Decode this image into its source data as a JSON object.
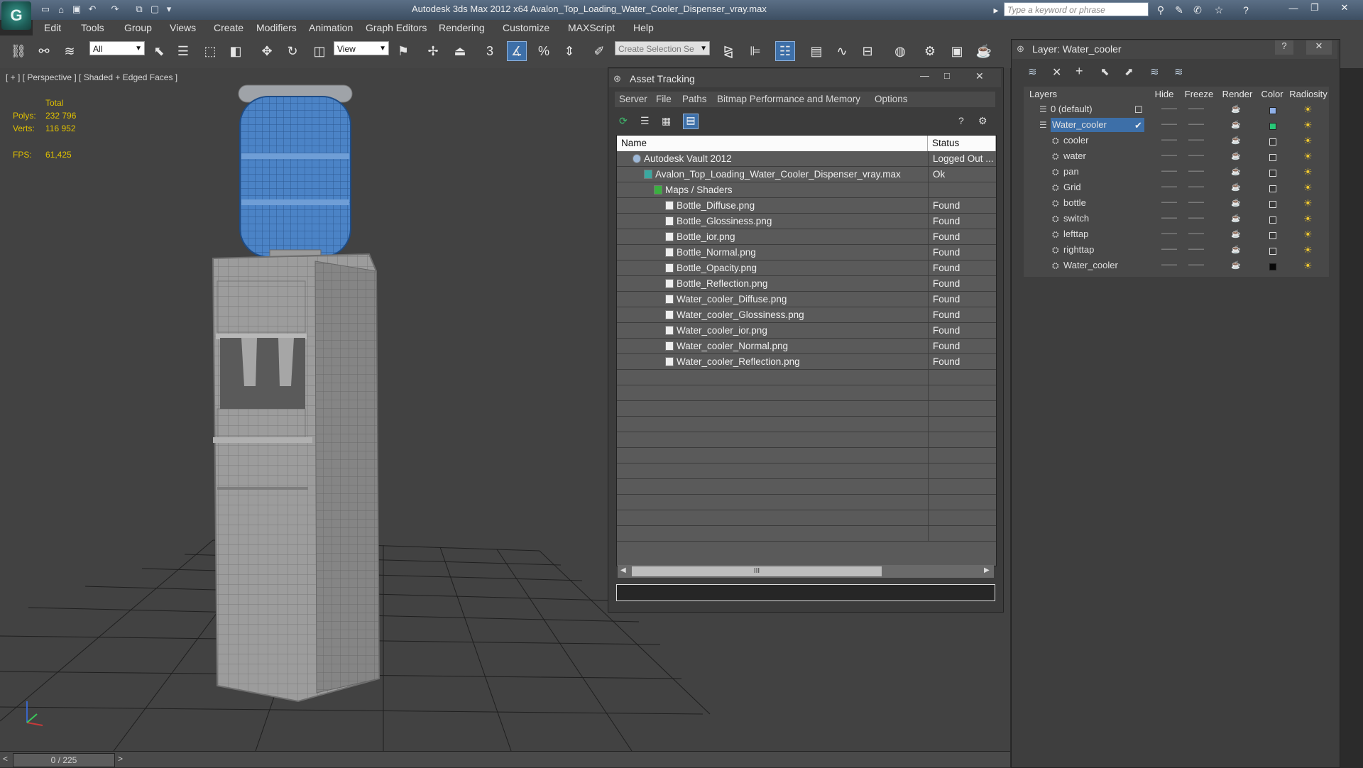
{
  "window": {
    "title": "Autodesk 3ds Max  2012 x64      Avalon_Top_Loading_Water_Cooler_Dispenser_vray.max",
    "search_placeholder": "Type a keyword or phrase",
    "logo_glyph": "G"
  },
  "menu": [
    "Edit",
    "Tools",
    "Group",
    "Views",
    "Create",
    "Modifiers",
    "Animation",
    "Graph Editors",
    "Rendering",
    "Customize",
    "MAXScript",
    "Help"
  ],
  "toolbar": {
    "selection_filter": "All",
    "reference_coord": "View",
    "named_selection": "Create Selection Se",
    "snap_label": "3"
  },
  "viewport": {
    "label": "[ + ] [ Perspective ] [ Shaded + Edged Faces ]",
    "stats": {
      "total_label": "Total",
      "polys_label": "Polys:",
      "polys_value": "232 796",
      "verts_label": "Verts:",
      "verts_value": "116 952",
      "fps_label": "FPS:",
      "fps_value": "61,425"
    },
    "time_slider": "0 / 225"
  },
  "asset_tracking": {
    "title": "Asset Tracking",
    "menu": [
      "Server",
      "File",
      "Paths",
      "Bitmap Performance and Memory",
      "Options"
    ],
    "columns": {
      "name": "Name",
      "status": "Status"
    },
    "rows": [
      {
        "name": "Autodesk Vault 2012",
        "status": "Logged Out ...",
        "indent": 0
      },
      {
        "name": "Avalon_Top_Loading_Water_Cooler_Dispenser_vray.max",
        "status": "Ok",
        "indent": 1
      },
      {
        "name": "Maps / Shaders",
        "status": "",
        "indent": 2
      },
      {
        "name": "Bottle_Diffuse.png",
        "status": "Found",
        "indent": 3
      },
      {
        "name": "Bottle_Glossiness.png",
        "status": "Found",
        "indent": 3
      },
      {
        "name": "Bottle_ior.png",
        "status": "Found",
        "indent": 3
      },
      {
        "name": "Bottle_Normal.png",
        "status": "Found",
        "indent": 3
      },
      {
        "name": "Bottle_Opacity.png",
        "status": "Found",
        "indent": 3
      },
      {
        "name": "Bottle_Reflection.png",
        "status": "Found",
        "indent": 3
      },
      {
        "name": "Water_cooler_Diffuse.png",
        "status": "Found",
        "indent": 3
      },
      {
        "name": "Water_cooler_Glossiness.png",
        "status": "Found",
        "indent": 3
      },
      {
        "name": "Water_cooler_ior.png",
        "status": "Found",
        "indent": 3
      },
      {
        "name": "Water_cooler_Normal.png",
        "status": "Found",
        "indent": 3
      },
      {
        "name": "Water_cooler_Reflection.png",
        "status": "Found",
        "indent": 3
      }
    ],
    "scroll_thumb": "III",
    "path_value": ""
  },
  "layers": {
    "title": "Layer: Water_cooler",
    "columns": {
      "layers": "Layers",
      "hide": "Hide",
      "freeze": "Freeze",
      "render": "Render",
      "color": "Color",
      "radiosity": "Radiosity"
    },
    "rows": [
      {
        "name": "0 (default)",
        "level": 0,
        "color": "#8fb0e8",
        "selected": false,
        "current": false
      },
      {
        "name": "Water_cooler",
        "level": 0,
        "color": "#28c878",
        "selected": true,
        "current": true
      },
      {
        "name": "cooler",
        "level": 1,
        "color": "#3a3a3a",
        "selected": false,
        "current": false
      },
      {
        "name": "water",
        "level": 1,
        "color": "#3a3a3a",
        "selected": false,
        "current": false
      },
      {
        "name": "pan",
        "level": 1,
        "color": "#3a3a3a",
        "selected": false,
        "current": false
      },
      {
        "name": "Grid",
        "level": 1,
        "color": "#3a3a3a",
        "selected": false,
        "current": false
      },
      {
        "name": "bottle",
        "level": 1,
        "color": "#3a3a3a",
        "selected": false,
        "current": false
      },
      {
        "name": "switch",
        "level": 1,
        "color": "#3a3a3a",
        "selected": false,
        "current": false
      },
      {
        "name": "lefttap",
        "level": 1,
        "color": "#3a3a3a",
        "selected": false,
        "current": false
      },
      {
        "name": "righttap",
        "level": 1,
        "color": "#3a3a3a",
        "selected": false,
        "current": false
      },
      {
        "name": "Water_cooler",
        "level": 1,
        "color": "#080808",
        "selected": false,
        "current": false
      }
    ]
  },
  "colors": {
    "accent_blue": "#3d6fa8",
    "stat_yellow": "#e0c000",
    "bottle_blue": "#4b83c6"
  }
}
